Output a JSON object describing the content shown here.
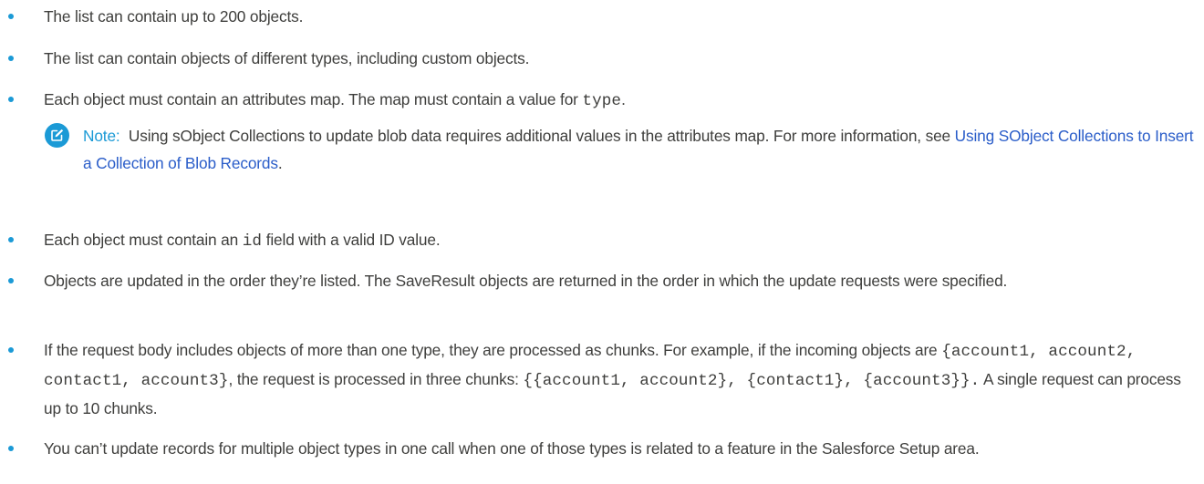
{
  "items": [
    {
      "text": "The list can contain up to 200 objects."
    },
    {
      "text": "The list can contain objects of different types, including custom objects."
    },
    {
      "text_before": "Each object must contain an attributes map. The map must contain a value for ",
      "code": "type",
      "text_after": "."
    },
    {
      "text_before": "Each object must contain an ",
      "code": "id",
      "text_after": " field with a valid ID value."
    },
    {
      "text": "Objects are updated in the order they’re listed. The SaveResult objects are returned in the order in which the update requests were specified."
    },
    {
      "text_before": "If the request body includes objects of more than one type, they are processed as chunks. For example, if the incoming objects are ",
      "code1": "{account1, account2, contact1, account3}",
      "text_middle": ", the request is processed in three chunks: ",
      "code2": "{{account1, account2}, {contact1}, {account3}}.",
      "text_after": " A single request can process up to 10 chunks."
    },
    {
      "text": "You can’t update records for multiple object types in one call when one of those types is related to a feature in the Salesforce Setup area."
    }
  ],
  "note": {
    "icon": "edit-note-icon",
    "label": "Note:",
    "text_before": "Using sObject Collections to update blob data requires additional values in the attributes map. For more information, see ",
    "link_text": "Using SObject Collections to Insert a Collection of Blob Records",
    "text_after": "."
  },
  "colors": {
    "bullet": "#1b9ad6",
    "note_label": "#1b9ad6",
    "link": "#2a5dc9",
    "body_text": "#3e3e3c"
  }
}
